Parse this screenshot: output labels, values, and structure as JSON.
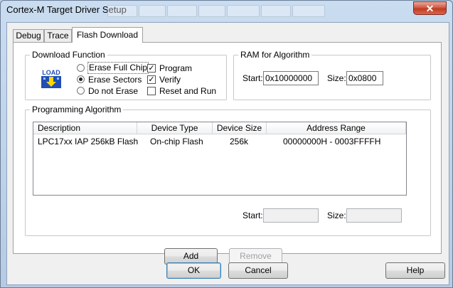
{
  "window": {
    "title": "Cortex-M Target Driver Setup",
    "close_glyph": "✕"
  },
  "tabs": [
    {
      "label": "Debug",
      "active": false
    },
    {
      "label": "Trace",
      "active": false
    },
    {
      "label": "Flash Download",
      "active": true
    }
  ],
  "download_function": {
    "title": "Download Function",
    "icon_text": "LOAD",
    "radios": [
      {
        "label": "Erase Full Chip",
        "selected": false
      },
      {
        "label": "Erase Sectors",
        "selected": true
      },
      {
        "label": "Do not Erase",
        "selected": false
      }
    ],
    "checks": [
      {
        "label": "Program",
        "checked": true
      },
      {
        "label": "Verify",
        "checked": true
      },
      {
        "label": "Reset and Run",
        "checked": false
      }
    ]
  },
  "ram_for_algorithm": {
    "title": "RAM for Algorithm",
    "start_label": "Start:",
    "start_value": "0x10000000",
    "size_label": "Size:",
    "size_value": "0x0800"
  },
  "programming_algorithm": {
    "title": "Programming Algorithm",
    "columns": [
      "Description",
      "Device Type",
      "Device Size",
      "Address Range"
    ],
    "rows": [
      {
        "description": "LPC17xx IAP 256kB Flash",
        "device_type": "On-chip Flash",
        "device_size": "256k",
        "address_range": "00000000H - 0003FFFFH"
      }
    ],
    "start_label": "Start:",
    "start_value": "",
    "size_label": "Size:",
    "size_value": ""
  },
  "buttons": {
    "add": "Add",
    "remove": "Remove",
    "ok": "OK",
    "cancel": "Cancel",
    "help": "Help"
  },
  "colors": {
    "accent": "#3c7fb1",
    "close": "#c13a22",
    "icon_blue": "#1f4fb5",
    "icon_yellow": "#ffd800"
  }
}
